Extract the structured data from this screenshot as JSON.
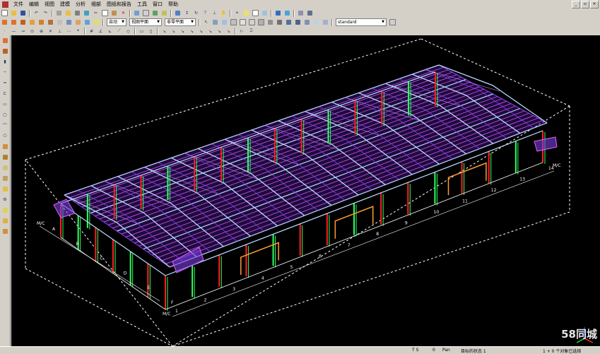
{
  "menu": {
    "items": [
      "文件",
      "编辑",
      "视图",
      "建模",
      "分析",
      "细部",
      "图纸和报告",
      "工具",
      "窗口",
      "帮助"
    ]
  },
  "window_buttons": {
    "minimize": "_",
    "restore": "▫",
    "close": "×"
  },
  "toolbar2": {
    "combo_position": "自动",
    "combo_view": "视图平面",
    "combo_plane": "非零平面",
    "combo_standard": "standard"
  },
  "viewport": {
    "background": "#000000",
    "grid_labels_side": [
      "A",
      "B",
      "C",
      "D",
      "E",
      "F"
    ],
    "grid_labels_front": [
      "1",
      "2",
      "3",
      "4",
      "5",
      "6",
      "7",
      "8",
      "9",
      "10",
      "11",
      "12",
      "13",
      "14"
    ],
    "corner_labels": [
      "M/C",
      "M/C",
      "M/C"
    ],
    "colors": {
      "roof": "#8a3cff",
      "purlin": "#e060ff",
      "frame": "#b8d8ff",
      "column_red": "#ff2020",
      "column_green": "#30ff60",
      "beam_orange": "#ff9a30",
      "bbox": "#ffffff"
    }
  },
  "status": {
    "ts": "T S",
    "zero": "0",
    "pan": "Pan",
    "selected": "目标的状态 1",
    "info": "1 + 0 个对象已选择"
  },
  "watermark": "58同城"
}
